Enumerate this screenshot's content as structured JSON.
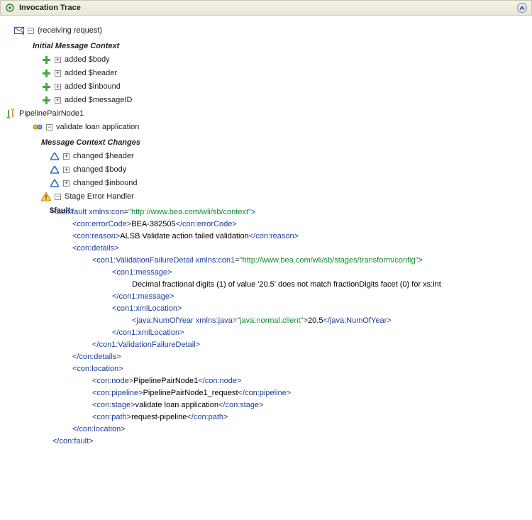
{
  "panel": {
    "title": "Invocation Trace"
  },
  "tree": {
    "receiving": "(receiving request)",
    "initialContext": "Initial Message Context",
    "added": [
      "added $body",
      "added $header",
      "added $inbound",
      "added $messageID"
    ],
    "pipeline": "PipelinePairNode1",
    "stage": "validate loan application",
    "changesHeader": "Message Context Changes",
    "changed": [
      "changed $header",
      "changed $body",
      "changed $inbound"
    ],
    "errorHandler": "Stage Error Handler",
    "faultLabel": "$fault:"
  },
  "fault": {
    "ns": "http://www.bea.com/wli/sb/context",
    "errorCode": "BEA-382505",
    "reason": "ALSB Validate action failed validation",
    "detailNs": "http://www.bea.com/wli/sb/stages/transform/config",
    "message": "Decimal fractional digits (1) of value '20.5' does not match fractionDigits facet (0) for xs:int",
    "javaNs": "java:normal.client",
    "numOfYear": "20.5",
    "location": {
      "node": "PipelinePairNode1",
      "pipeline": "PipelinePairNode1_request",
      "stage": "validate loan application",
      "path": "request-pipeline"
    }
  }
}
